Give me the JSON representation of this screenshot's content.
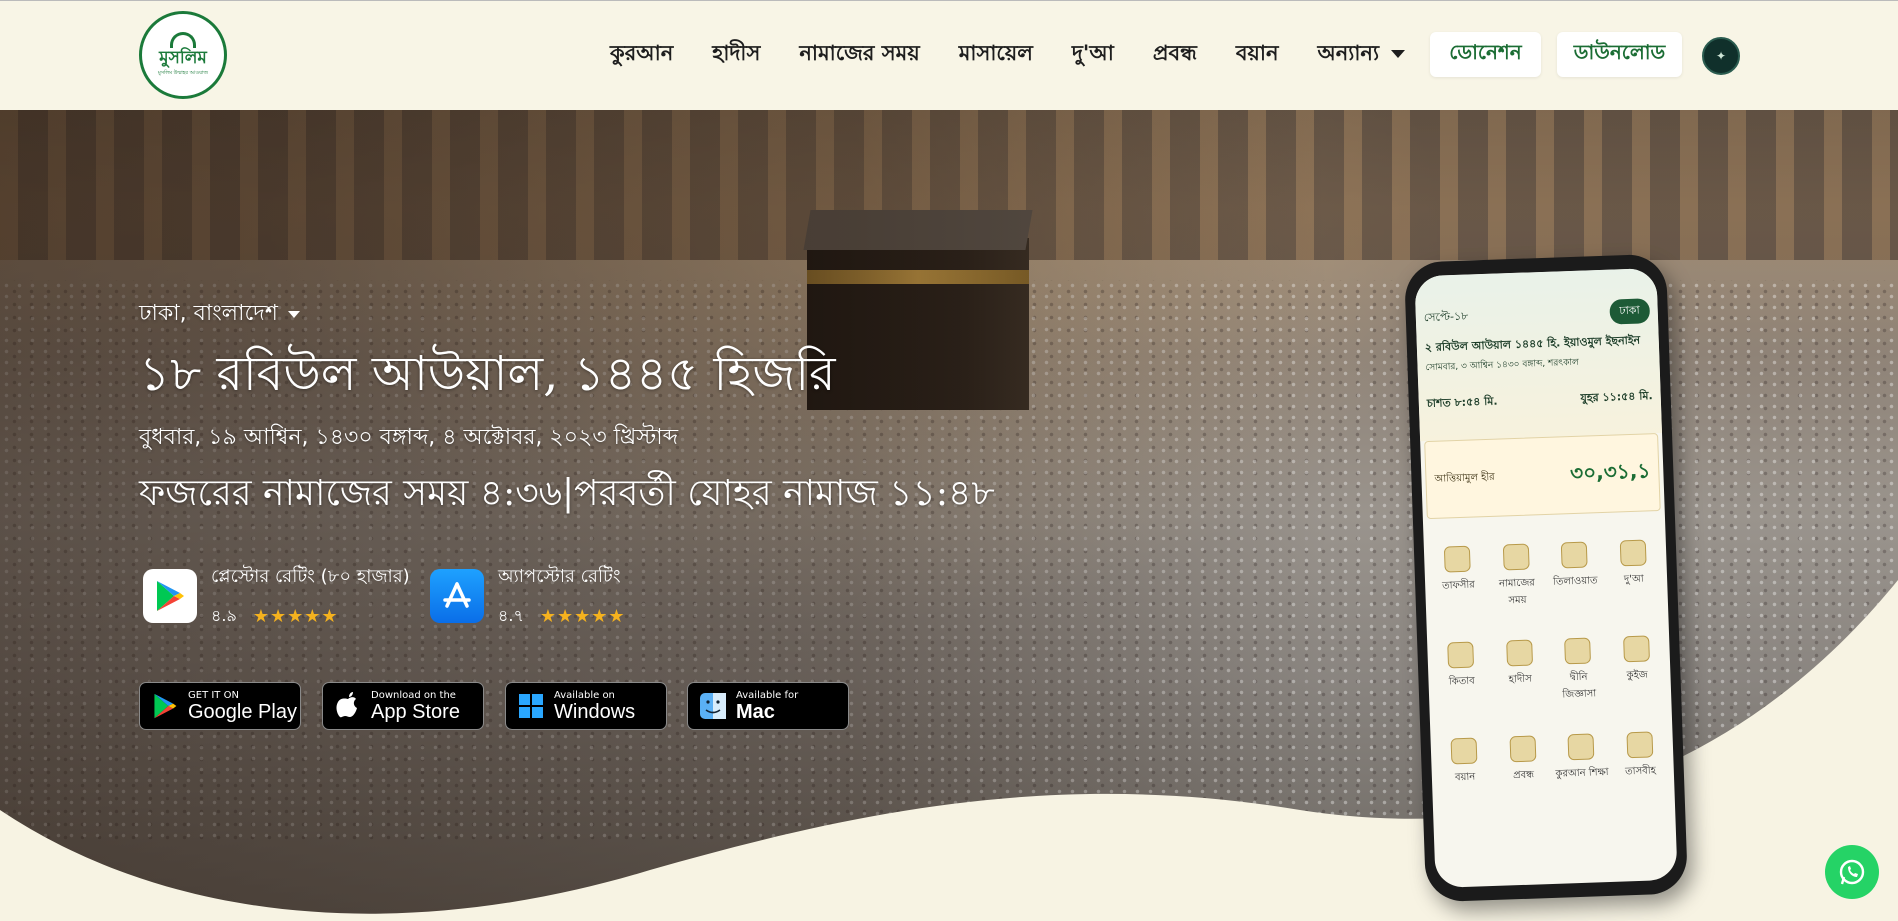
{
  "header": {
    "logo_text": "মুসলিম",
    "logo_sub": "মুসলিম উম্মাহর আওয়াজ",
    "nav": [
      "কুরআন",
      "হাদীস",
      "নামাজের সময়",
      "মাসায়েল",
      "দু'আ",
      "প্রবন্ধ",
      "বয়ান",
      "অন্যান্য"
    ],
    "donate_label": "ডোনেশন",
    "download_label": "ডাউনলোড"
  },
  "hero": {
    "location": "ঢাকা, বাংলাদেশ",
    "hijri_date": "১৮ রবিউল আউয়াল, ১৪৪৫ হিজরি",
    "dates": "বুধবার, ১৯ আশ্বিন, ১৪৩০ বঙ্গাব্দ, ৪ অক্টোবর, ২০২৩ খ্রিস্টাব্দ",
    "prayer_line": "ফজরের নামাজের সময় ৪:৩৬|পরবর্তী যোহর নামাজ ১১:৪৮"
  },
  "ratings": {
    "playstore": {
      "label": "প্লেস্টোর রেটিং (৮০ হাজার)",
      "score": "৪.৯",
      "stars": 5
    },
    "appstore": {
      "label": "অ্যাপস্টোর রেটিং",
      "score": "৪.৭",
      "stars": 5
    }
  },
  "stores": [
    {
      "small": "GET IT ON",
      "big": "Google Play",
      "icon": "google-play-icon"
    },
    {
      "small": "Download on the",
      "big": "App Store",
      "icon": "apple-icon"
    },
    {
      "small": "Available on",
      "big": "Windows",
      "icon": "windows-icon"
    },
    {
      "small": "Available for",
      "big": "Mac",
      "icon": "mac-finder-icon"
    }
  ],
  "phone": {
    "date_small": "সেপ্টে-১৮",
    "city_pill": "ঢাকা",
    "hijri": "২ রবিউল আউয়াল ১৪৪৫ হি. ইয়াওমুল ইছনাইন",
    "sub": "সোমবার, ৩ আশ্বিন ১৪৩০ বঙ্গাব্দ, শরৎকাল",
    "left_time": "চাশত ৮:৫৪ মি.",
    "right_time": "যুহর ১১:৫৪ মি.",
    "banner_title": "আত্তিয়ামুল হীর",
    "banner_num": "৩০,৩১,১",
    "grid": [
      "তাফসীর",
      "নামাজের সময়",
      "তিলাওয়াত",
      "দু'আ",
      "কিতাব",
      "হাদীস",
      "দ্বীনি জিজ্ঞাসা",
      "কুইজ",
      "বয়ান",
      "প্রবন্ধ",
      "কুরআন শিক্ষা",
      "তাসবীহ"
    ]
  },
  "colors": {
    "brand_green": "#1b6d34",
    "header_bg": "#f8f5e6",
    "star": "#f5b21e",
    "whatsapp": "#25d366"
  }
}
